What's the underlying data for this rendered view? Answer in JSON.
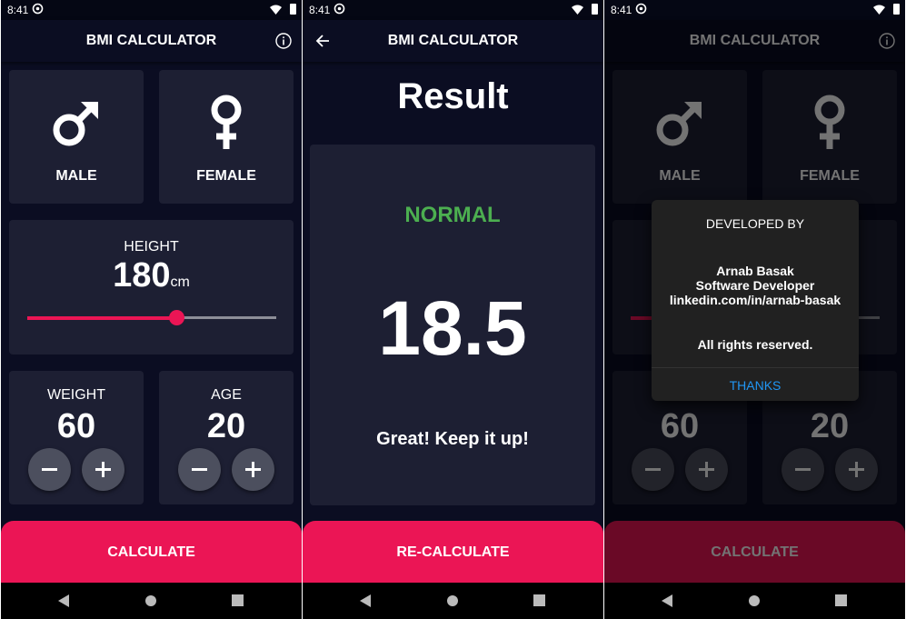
{
  "status_time": "8:41",
  "calculator": {
    "title": "BMI CALCULATOR",
    "male_label": "MALE",
    "female_label": "FEMALE",
    "height_label": "HEIGHT",
    "height_value": "180",
    "height_unit": "cm",
    "height_slider_fraction": 0.6,
    "weight_label": "WEIGHT",
    "weight_value": "60",
    "age_label": "AGE",
    "age_value": "20",
    "calculate_label": "CALCULATE"
  },
  "result": {
    "title": "BMI CALCULATOR",
    "heading": "Result",
    "status": "NORMAL",
    "bmi": "18.5",
    "message": "Great! Keep it up!",
    "recalculate_label": "RE-CALCULATE"
  },
  "dialog": {
    "title": "DEVELOPED BY",
    "name": "Arnab Basak",
    "role": "Software Developer",
    "link": "linkedin.com/in/arnab-basak",
    "rights": "All rights reserved.",
    "button": "THANKS"
  },
  "colors": {
    "background": "#0b0d22",
    "card": "#1d1f33",
    "accent": "#eb1555",
    "normal_green": "#4caf50",
    "dialog_button": "#2196f3"
  },
  "icons": [
    "sync-icon",
    "wifi-icon",
    "battery-icon",
    "info-icon",
    "back-arrow-icon",
    "mars-icon",
    "venus-icon",
    "minus-icon",
    "plus-icon",
    "nav-back-icon",
    "nav-home-icon",
    "nav-recents-icon"
  ]
}
